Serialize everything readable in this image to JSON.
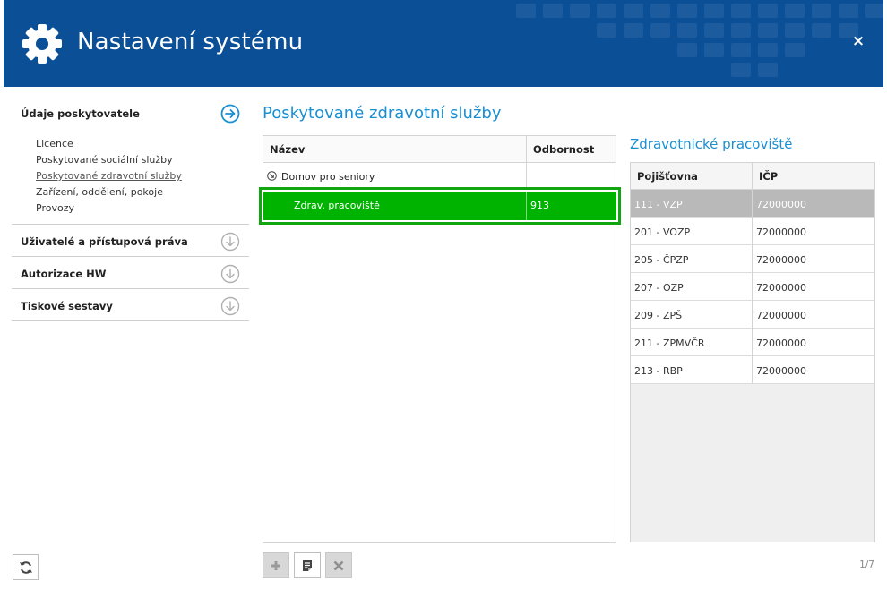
{
  "header": {
    "title": "Nastavení systému",
    "close_glyph": "×",
    "gear_icon": "gear-icon",
    "color": "#0b4f96"
  },
  "nav": {
    "sections": [
      {
        "label": "Údaje poskytovatele",
        "state": "expanded",
        "icon": "arrow-right-circle-icon",
        "items": [
          {
            "label": "Licence",
            "active": false
          },
          {
            "label": "Poskytované sociální služby",
            "active": false
          },
          {
            "label": "Poskytované zdravotní služby",
            "active": true
          },
          {
            "label": "Zařízení, oddělení, pokoje",
            "active": false
          },
          {
            "label": "Provozy",
            "active": false
          }
        ]
      },
      {
        "label": "Uživatelé a přístupová práva",
        "state": "collapsed",
        "icon": "arrow-down-circle-icon"
      },
      {
        "label": "Autorizace HW",
        "state": "collapsed",
        "icon": "arrow-down-circle-icon"
      },
      {
        "label": "Tiskové sestavy",
        "state": "collapsed",
        "icon": "arrow-down-circle-icon"
      }
    ],
    "accent": "#1a8fd3"
  },
  "main": {
    "title": "Poskytované zdravotní služby",
    "grid": {
      "columns": [
        "Název",
        "Odbornost"
      ],
      "rows": [
        {
          "name": "Domov pro seniory",
          "odbornost": "",
          "level": 0,
          "expander": "collapse-circle-icon"
        },
        {
          "name": "Zdrav. pracoviště",
          "odbornost": "913",
          "level": 1,
          "selected": true
        }
      ],
      "selection_color": "#00b300"
    },
    "toolbar": [
      {
        "name": "add",
        "icon": "plus-icon",
        "enabled": false
      },
      {
        "name": "edit",
        "icon": "document-edit-icon",
        "enabled": true
      },
      {
        "name": "delete",
        "icon": "x-icon",
        "enabled": false
      }
    ]
  },
  "right": {
    "title": "Zdravotnické pracoviště",
    "columns": [
      "Pojišťovna",
      "IČP"
    ],
    "rows": [
      {
        "pojistovna": "111 - VZP",
        "icp": "72000000",
        "selected": true
      },
      {
        "pojistovna": "201 - VOZP",
        "icp": "72000000"
      },
      {
        "pojistovna": "205 - ČPZP",
        "icp": "72000000"
      },
      {
        "pojistovna": "207 - OZP",
        "icp": "72000000"
      },
      {
        "pojistovna": "209 - ZPŠ",
        "icp": "72000000"
      },
      {
        "pojistovna": "211 - ZPMVČR",
        "icp": "72000000"
      },
      {
        "pojistovna": "213 - RBP",
        "icp": "72000000"
      }
    ]
  },
  "footer": {
    "refresh_icon": "refresh-icon",
    "pager": "1/7"
  }
}
